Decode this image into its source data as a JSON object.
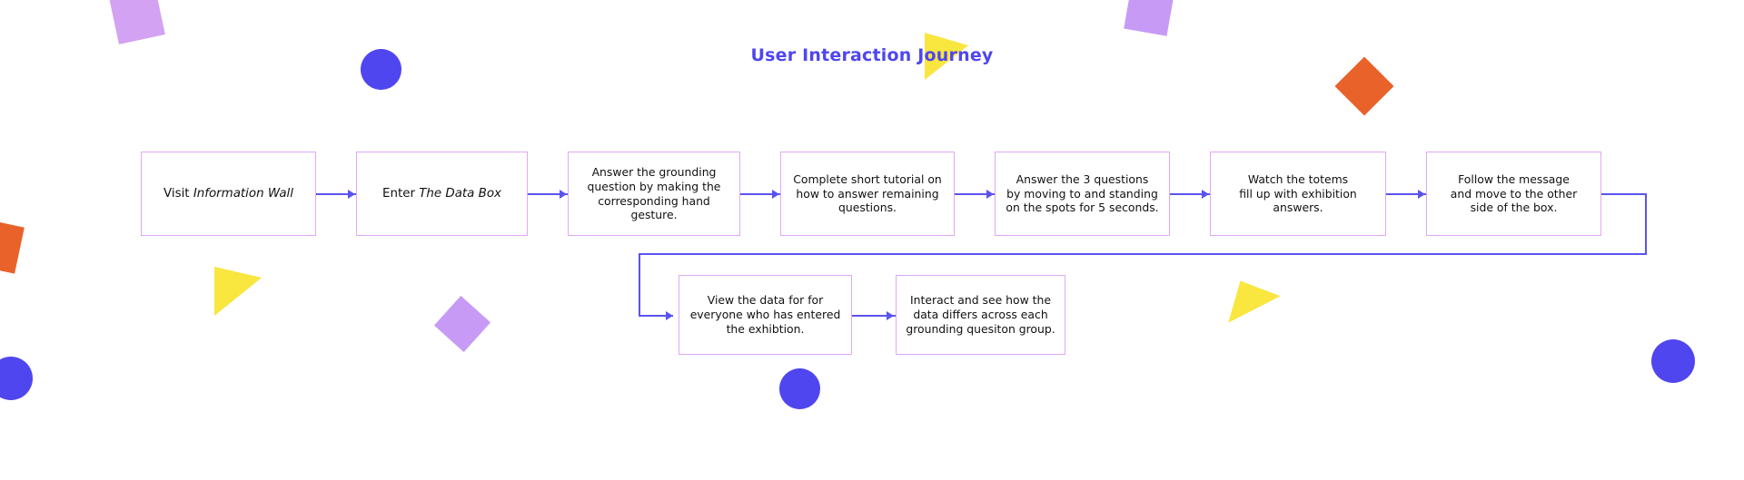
{
  "page": {
    "title": "User Interaction Journey",
    "background_color": "#ffffff",
    "title_color": "#4f46f0",
    "node_border_color": "#e0a8f5",
    "connector_color": "#5b53f0"
  },
  "flow": {
    "top_row": [
      {
        "id": "visit-information-wall",
        "prefix": "Visit ",
        "emphasis": "Information Wall",
        "suffix": "",
        "full_text": "Visit Information Wall"
      },
      {
        "id": "enter-the-data-box",
        "prefix": "Enter ",
        "emphasis": "The Data Box",
        "suffix": "",
        "full_text": "Enter The Data Box"
      },
      {
        "id": "answer-grounding-question",
        "full_text": "Answer the grounding\nquestion by making the\ncorresponding hand\ngesture."
      },
      {
        "id": "complete-short-tutorial",
        "full_text": "Complete short tutorial on\nhow to answer remaining\nquestions."
      },
      {
        "id": "answer-three-questions",
        "full_text": "Answer the 3 questions\nby moving to and standing\non the spots for 5 seconds."
      },
      {
        "id": "watch-totems-fill-up",
        "full_text": "Watch the totems\nfill up with exhibition\nanswers."
      },
      {
        "id": "follow-the-message",
        "full_text": "Follow the message\nand move to the other\nside of the box."
      }
    ],
    "bottom_row": [
      {
        "id": "view-the-data",
        "full_text": "View the data for for\neveryone who has entered\nthe exhibtion."
      },
      {
        "id": "interact-and-see-differences",
        "full_text": "Interact and see how the\ndata differs across each\ngrounding quesiton group."
      }
    ]
  },
  "decorations": [
    {
      "name": "purple-square-top-left",
      "shape": "square",
      "color": "#d3a2f2"
    },
    {
      "name": "blue-circle-top-left",
      "shape": "circle",
      "color": "#5046f0"
    },
    {
      "name": "yellow-triangle-top",
      "shape": "triangle",
      "color": "#f9e63f"
    },
    {
      "name": "purple-square-top-right",
      "shape": "square",
      "color": "#c79bf5"
    },
    {
      "name": "orange-diamond-top-right",
      "shape": "square",
      "color": "#e8622a"
    },
    {
      "name": "orange-shape-left",
      "shape": "square",
      "color": "#e8622a"
    },
    {
      "name": "yellow-triangle-bottom-left",
      "shape": "triangle",
      "color": "#f9e63f"
    },
    {
      "name": "purple-diamond-bottom",
      "shape": "square",
      "color": "#c79bf5"
    },
    {
      "name": "blue-circle-bottom-left",
      "shape": "circle",
      "color": "#5046f0"
    },
    {
      "name": "orange-square-bottom",
      "shape": "square",
      "color": "#e8622a"
    },
    {
      "name": "yellow-triangle-bottom-right",
      "shape": "triangle",
      "color": "#f9e63f"
    },
    {
      "name": "blue-circle-bottom-center",
      "shape": "circle",
      "color": "#5046f0"
    },
    {
      "name": "blue-circle-bottom-right",
      "shape": "circle",
      "color": "#5046f0"
    }
  ]
}
